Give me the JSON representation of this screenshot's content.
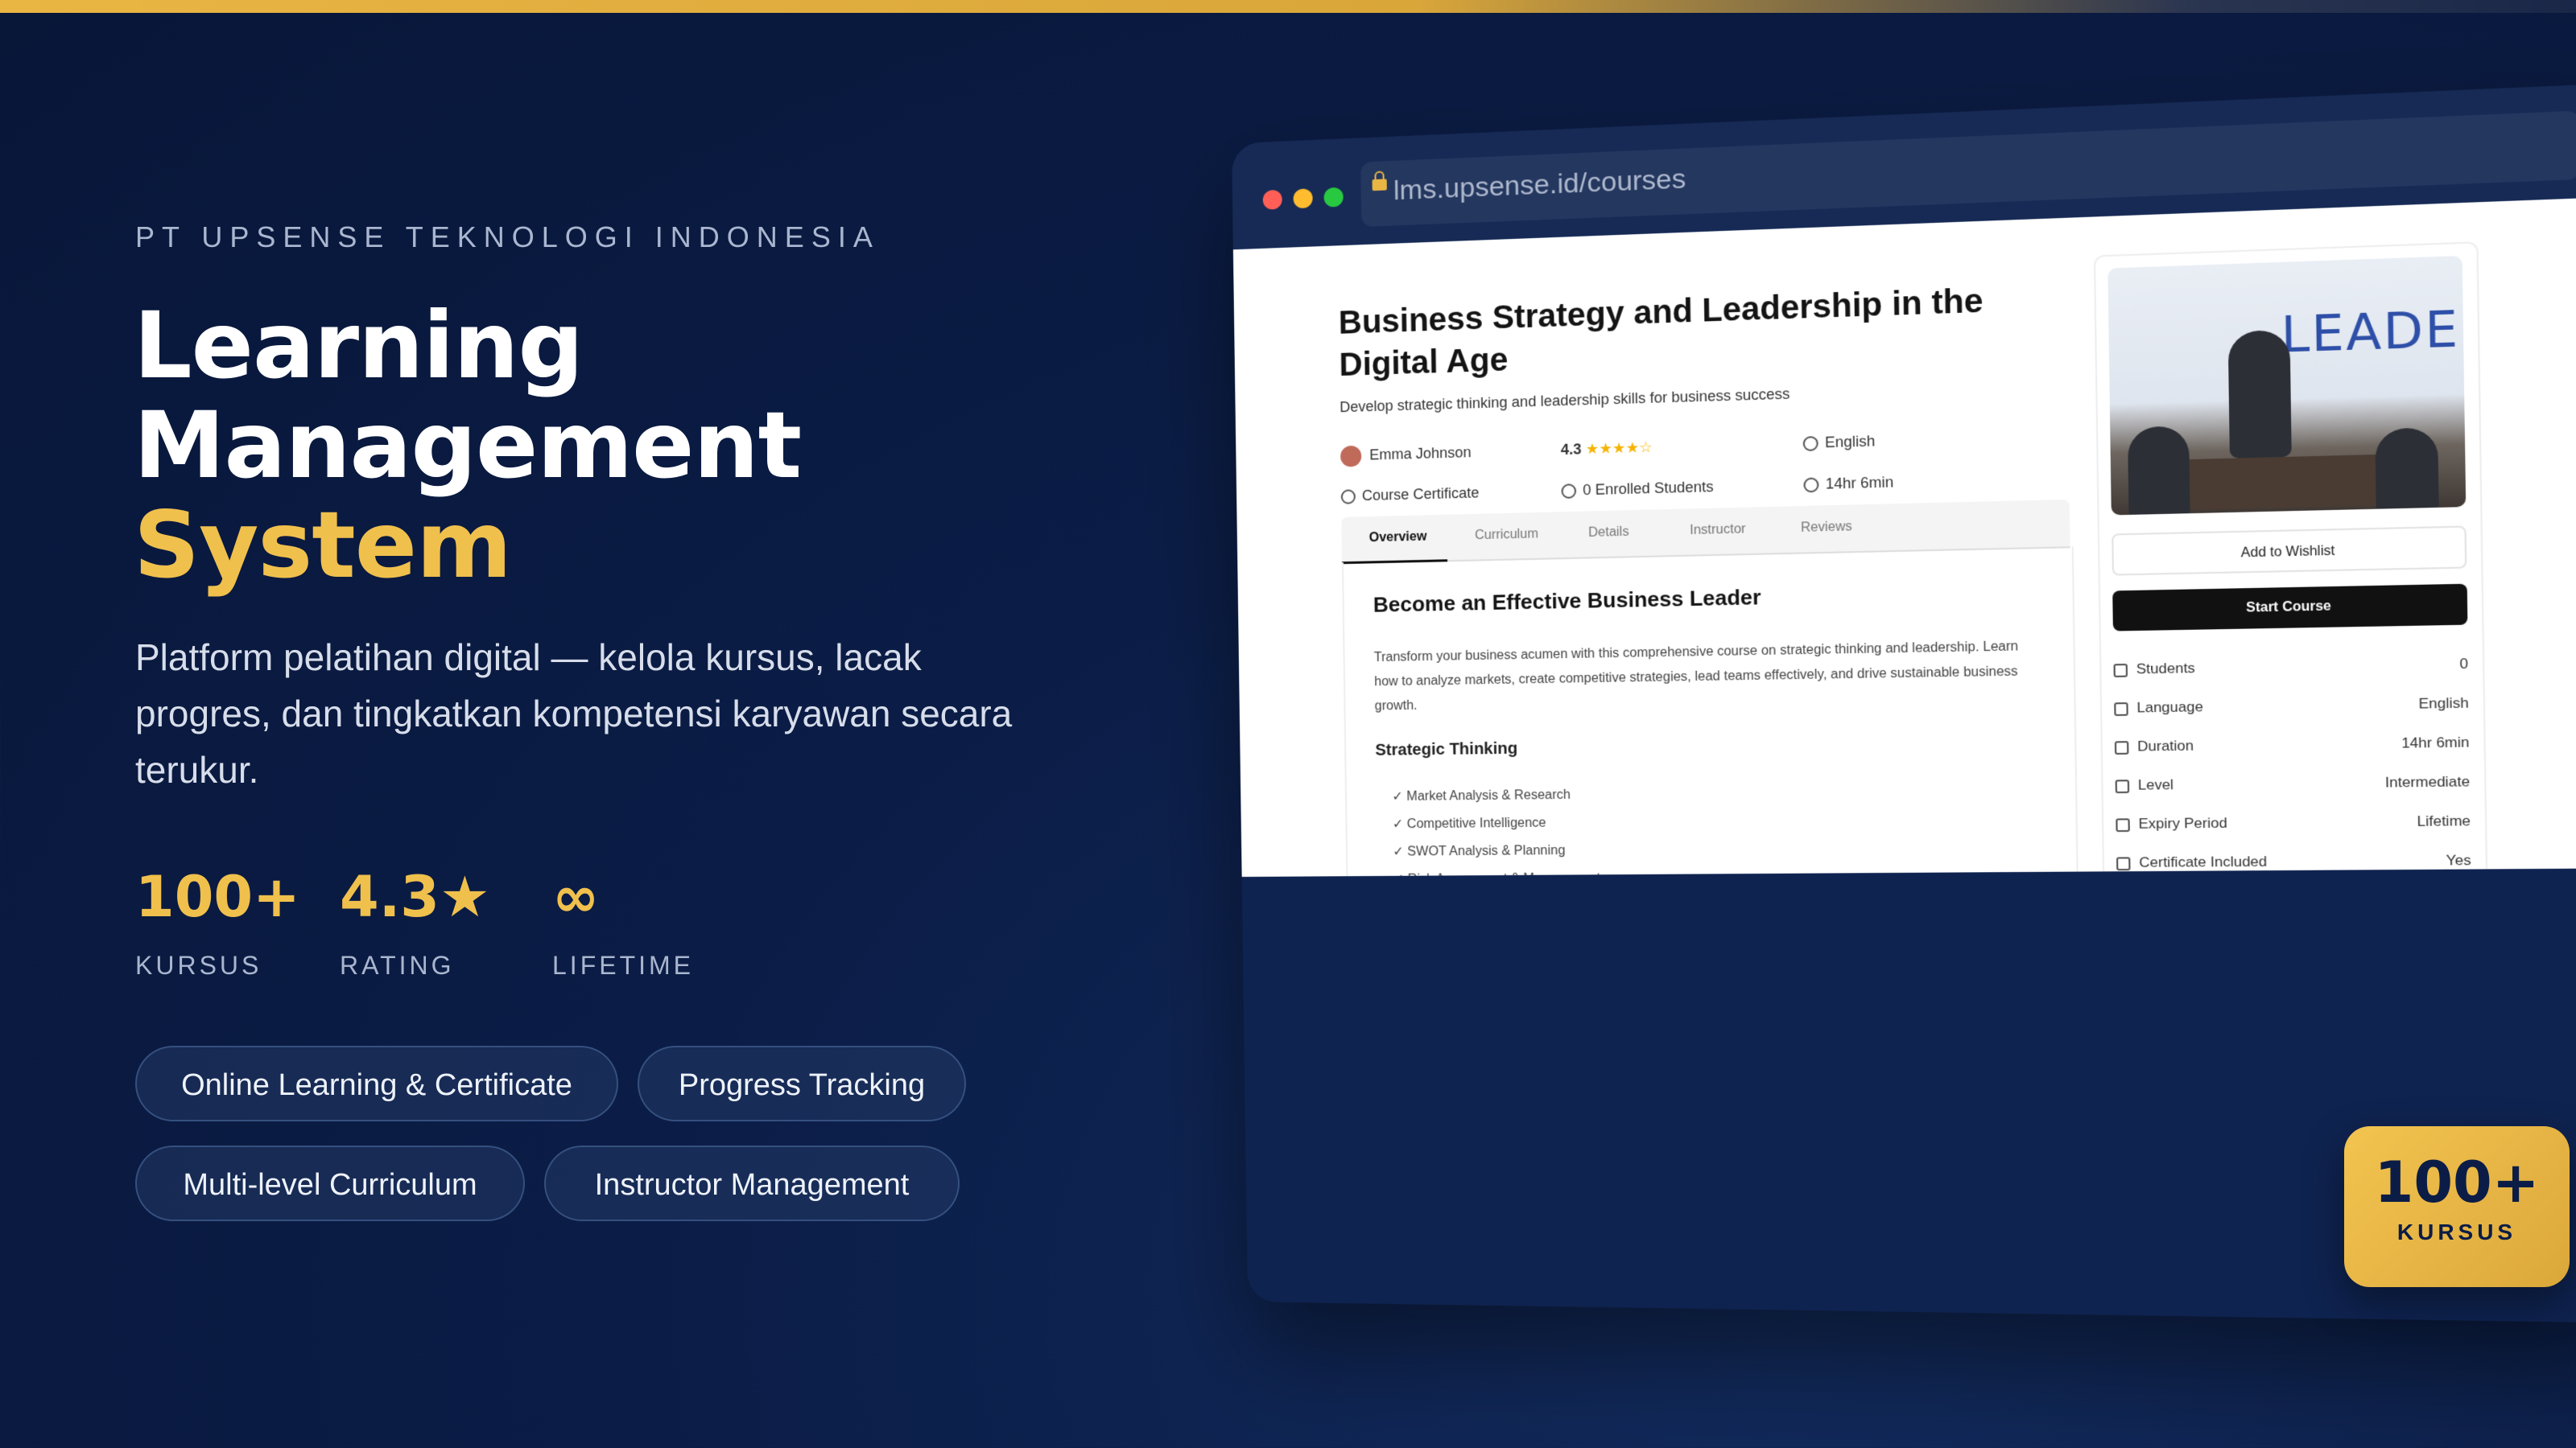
{
  "hero": {
    "company": "PT UPSENSE TEKNOLOGI INDONESIA",
    "title_line1": "Learning",
    "title_line2": "Management",
    "title_line3": "System",
    "description": "Platform pelatihan digital — kelola kursus, lacak progres, dan tingkatkan kompetensi karyawan secara terukur.",
    "stats": [
      {
        "value": "100+",
        "label": "KURSUS"
      },
      {
        "value": "4.3★",
        "label": "RATING"
      },
      {
        "value": "∞",
        "label": "LIFETIME"
      }
    ],
    "features": [
      "Online Learning & Certificate",
      "Progress Tracking",
      "Multi-level Curriculum",
      "Instructor Management"
    ]
  },
  "browser": {
    "url": "lms.upsense.id/courses",
    "dot_colors": [
      "#ff5f57",
      "#febc2e",
      "#28c840"
    ]
  },
  "course": {
    "title": "Business Strategy and Leadership in the Digital Age",
    "subtitle": "Develop strategic thinking and leadership skills for business success",
    "instructor": "Emma Johnson",
    "rating": "4.3",
    "stars": "★★★★☆",
    "language": "English",
    "certificate": "Course Certificate",
    "enrolled": "0 Enrolled Students",
    "duration": "14hr 6min",
    "tabs": [
      "Overview",
      "Curriculum",
      "Details",
      "Instructor",
      "Reviews"
    ],
    "overview_heading": "Become an Effective Business Leader",
    "overview_text": "Transform your business acumen with this comprehensive course on strategic thinking and leadership. Learn how to analyze markets, create competitive strategies, lead teams effectively, and drive sustainable business growth.",
    "section_heading": "Strategic Thinking",
    "bullets": [
      "✓ Market Analysis & Research",
      "✓ Competitive Intelligence",
      "✓ SWOT Analysis & Planning",
      "✓ Risk Assessment & Management"
    ],
    "thumbnail_text": "LEADER",
    "wishlist_label": "Add to Wishlist",
    "start_label": "Start Course",
    "info": [
      {
        "label": "Students",
        "value": "0"
      },
      {
        "label": "Language",
        "value": "English"
      },
      {
        "label": "Duration",
        "value": "14hr 6min"
      },
      {
        "label": "Level",
        "value": "Intermediate"
      },
      {
        "label": "Expiry Period",
        "value": "Lifetime"
      },
      {
        "label": "Certificate Included",
        "value": "Yes"
      }
    ]
  },
  "badge": {
    "value": "100+",
    "label": "KURSUS"
  },
  "colors": {
    "accent": "#f0c04d",
    "background": "#0b1d47"
  }
}
